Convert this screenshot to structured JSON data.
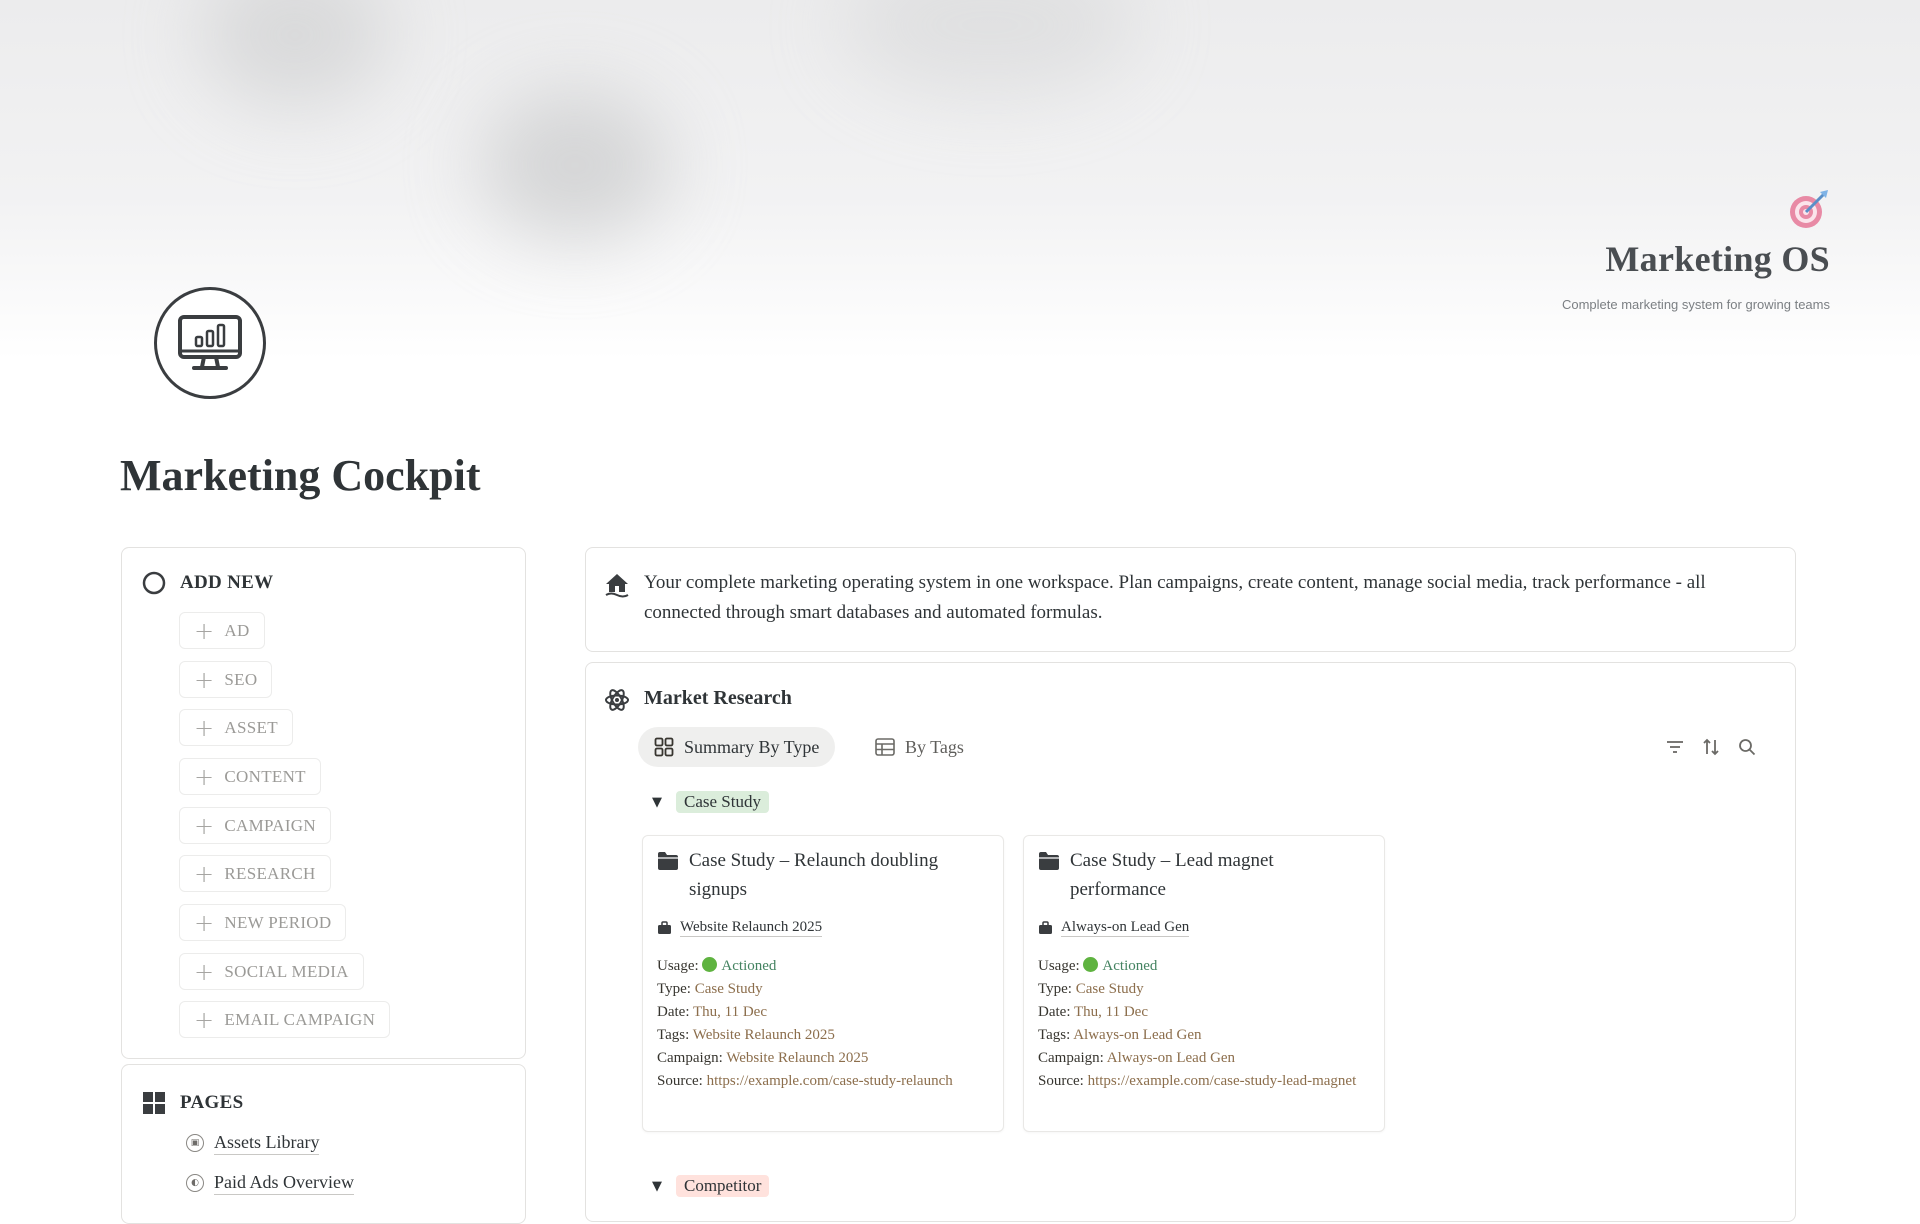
{
  "cover": {
    "brand_icon": "target-dart-icon",
    "brand_title": "Marketing OS",
    "brand_subtitle": "Complete marketing system for growing teams"
  },
  "page": {
    "icon": "monitor-chart-icon",
    "title": "Marketing Cockpit"
  },
  "add_new": {
    "heading": "ADD NEW",
    "buttons": [
      "AD",
      "SEO",
      "ASSET",
      "CONTENT",
      "CAMPAIGN",
      "RESEARCH",
      "NEW PERIOD",
      "SOCIAL MEDIA",
      "EMAIL CAMPAIGN"
    ]
  },
  "pages": {
    "heading": "PAGES",
    "links": [
      "Assets Library",
      "Paid Ads Overview"
    ]
  },
  "callout": {
    "icon": "house-icon",
    "text": "Your complete marketing operating system in one workspace. Plan campaigns, create content, manage social media, track performance - all connected through smart databases and automated formulas."
  },
  "research": {
    "icon": "atom-icon",
    "title": "Market Research",
    "tabs": [
      {
        "label": "Summary By Type",
        "icon": "gallery-icon",
        "active": true
      },
      {
        "label": "By Tags",
        "icon": "table-icon",
        "active": false
      }
    ],
    "tools": [
      "filter-icon",
      "sort-icon",
      "search-icon"
    ],
    "groups": [
      {
        "name": "Case Study",
        "color": "#dbeddb",
        "cards": [
          {
            "title": "Case Study – Relaunch doubling signups",
            "campaign": "Website Relaunch 2025",
            "usage_label": "Usage:",
            "usage": "Actioned",
            "type_label": "Type:",
            "type": "Case Study",
            "date_label": "Date:",
            "date": "Thu, 11 Dec",
            "tags_label": "Tags:",
            "tags": "Website Relaunch 2025",
            "campaign_label": "Campaign:",
            "campaign_value": "Website Relaunch 2025",
            "source_label": "Source:",
            "source": "https://example.com/case-study-relaunch"
          },
          {
            "title": "Case Study – Lead magnet performance",
            "campaign": "Always-on Lead Gen",
            "usage_label": "Usage:",
            "usage": "Actioned",
            "type_label": "Type:",
            "type": "Case Study",
            "date_label": "Date:",
            "date": "Thu, 11 Dec",
            "tags_label": "Tags:",
            "tags": "Always-on Lead Gen",
            "campaign_label": "Campaign:",
            "campaign_value": "Always-on Lead Gen",
            "source_label": "Source:",
            "source": "https://example.com/case-study-lead-magnet"
          }
        ]
      },
      {
        "name": "Competitor",
        "color": "#ffe2dd",
        "cards": []
      }
    ]
  }
}
